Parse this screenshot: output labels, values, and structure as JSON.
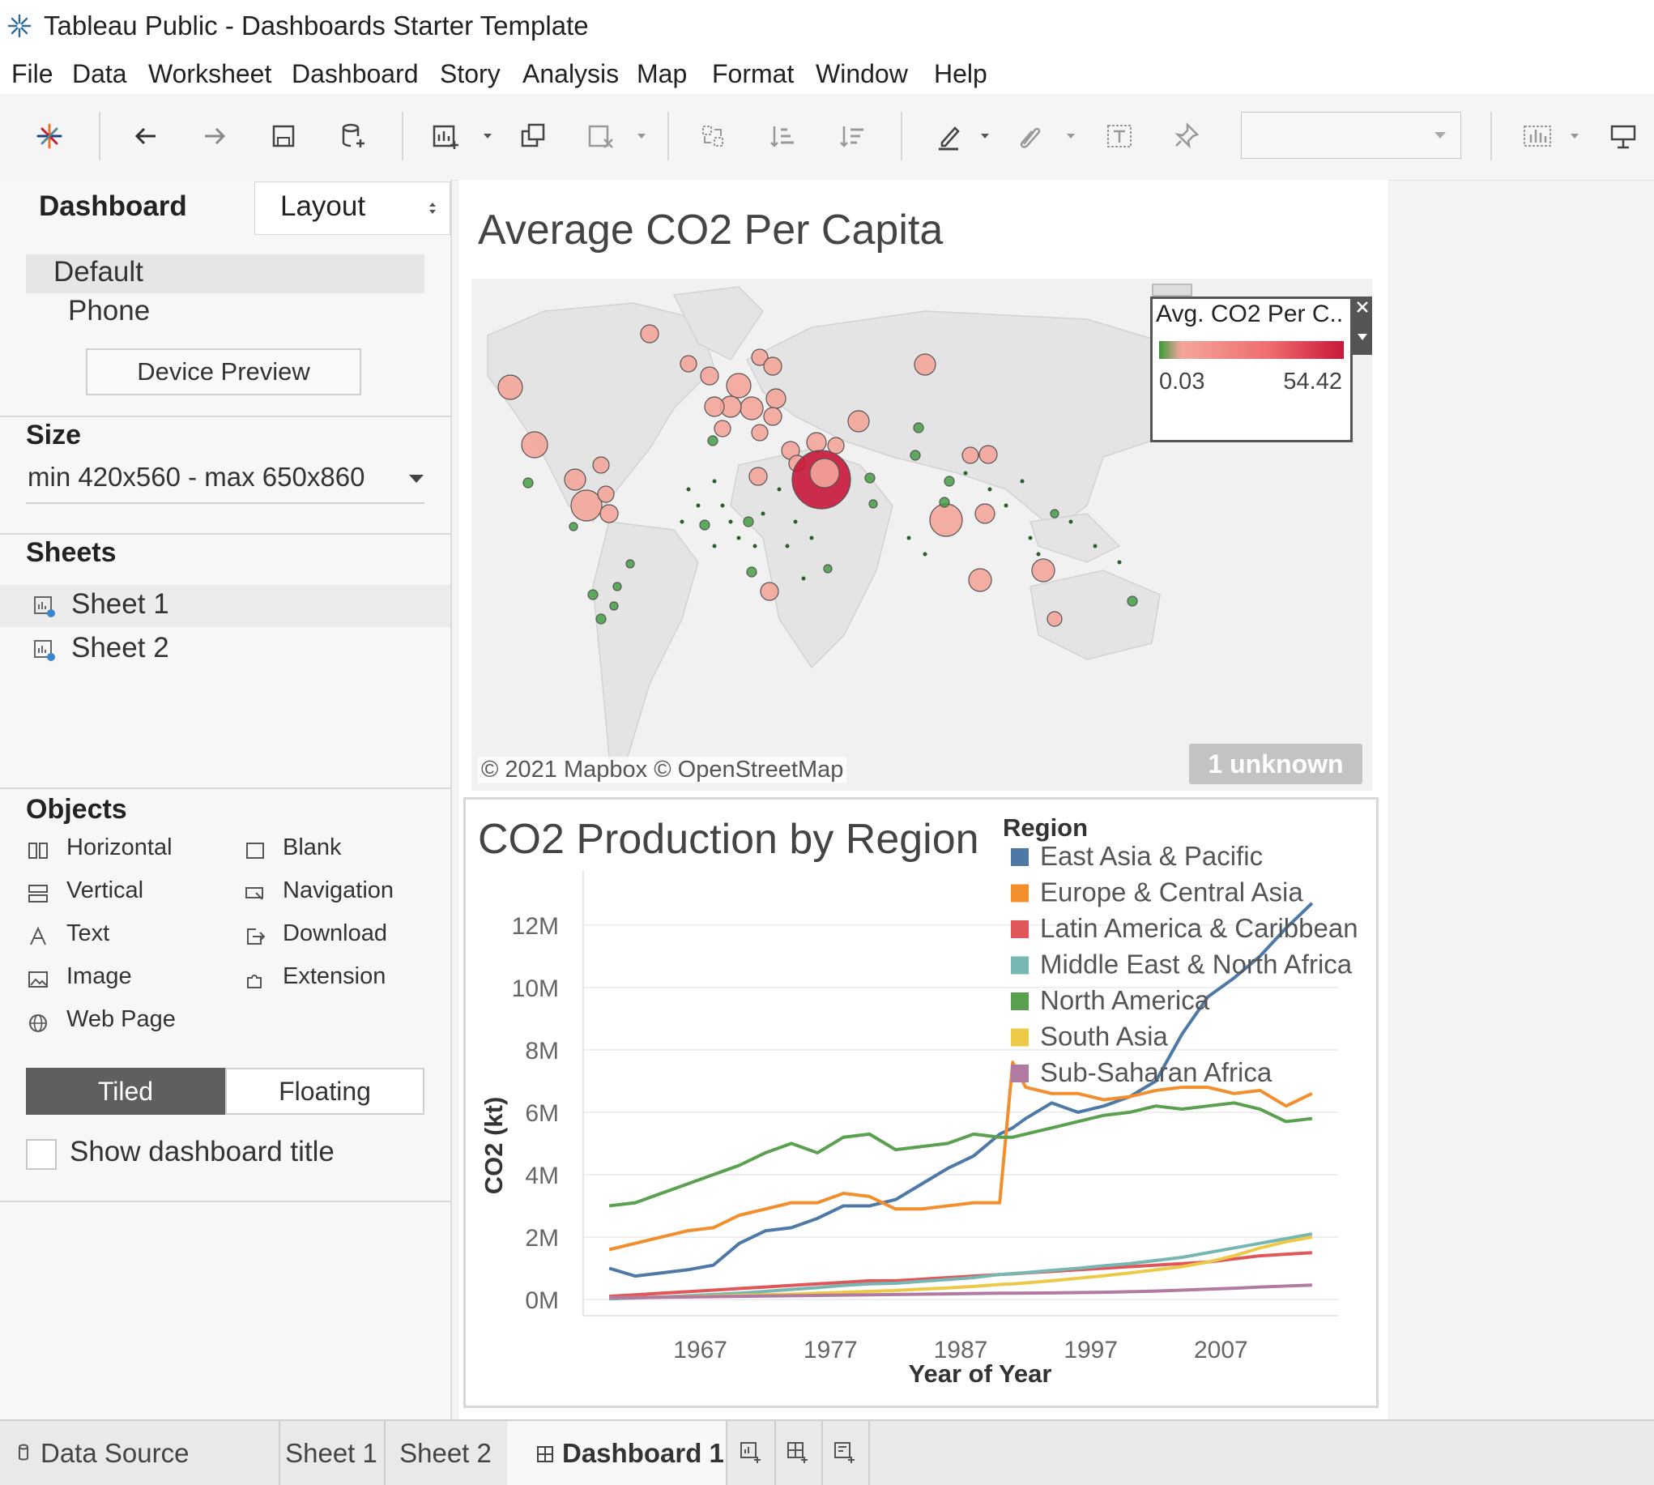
{
  "window": {
    "title": "Tableau Public - Dashboards Starter Template"
  },
  "menu": [
    "File",
    "Data",
    "Worksheet",
    "Dashboard",
    "Story",
    "Analysis",
    "Map",
    "Format",
    "Window",
    "Help"
  ],
  "toolbar": {
    "icons": [
      "tableau-logo-icon",
      "undo-icon",
      "redo-icon",
      "save-icon",
      "new-data-source-icon",
      "new-worksheet-icon",
      "duplicate-sheet-icon",
      "clear-sheet-icon",
      "swap-rows-columns-icon",
      "sort-ascending-icon",
      "sort-descending-icon",
      "highlight-icon",
      "annotate-icon",
      "show-labels-icon",
      "pin-icon",
      "show-me-icon",
      "presentation-mode-icon"
    ],
    "combo_value": ""
  },
  "left_panel": {
    "tab_dashboard": "Dashboard",
    "tab_layout": "Layout",
    "devices": [
      "Default",
      "Phone"
    ],
    "device_preview": "Device Preview",
    "size_heading": "Size",
    "size_value": "min 420x560 - max 650x860",
    "sheets_heading": "Sheets",
    "sheets": [
      "Sheet 1",
      "Sheet 2"
    ],
    "objects_heading": "Objects",
    "objects": [
      "Horizontal",
      "Blank",
      "Vertical",
      "Navigation",
      "Text",
      "Download",
      "Image",
      "Extension",
      "Web Page"
    ],
    "tiled": "Tiled",
    "floating": "Floating",
    "show_title": "Show dashboard title",
    "show_title_checked": false
  },
  "map": {
    "title": "Average CO2 Per Capita",
    "legend_title": "Avg. CO2 Per C..",
    "legend_min": "0.03",
    "legend_max": "54.42",
    "attribution": "© 2021 Mapbox © OpenStreetMap",
    "unknown_badge": "1 unknown",
    "colors": {
      "low": "#3a9a3a",
      "mid": "#f4a59a",
      "high": "#c8173a"
    }
  },
  "chart_data": {
    "type": "line",
    "title": "CO2 Production by Region",
    "xlabel": "Year of Year",
    "ylabel": "CO2 (kt)",
    "legend_title": "Region",
    "legend_position": "top-right",
    "x_ticks": [
      "1967",
      "1977",
      "1987",
      "1997",
      "2007"
    ],
    "y_ticks": [
      "0M",
      "2M",
      "4M",
      "6M",
      "8M",
      "10M",
      "12M"
    ],
    "ylim": [
      0,
      13500000
    ],
    "x": [
      1960,
      1962,
      1964,
      1966,
      1968,
      1970,
      1972,
      1974,
      1976,
      1978,
      1980,
      1982,
      1984,
      1986,
      1988,
      1990,
      1991,
      1992,
      1994,
      1996,
      1998,
      2000,
      2002,
      2004,
      2006,
      2008,
      2010,
      2012,
      2014
    ],
    "series": [
      {
        "name": "East Asia & Pacific",
        "color": "#4e79a7",
        "values": [
          1000000,
          750000,
          850000,
          950000,
          1100000,
          1800000,
          2200000,
          2300000,
          2600000,
          3000000,
          3000000,
          3200000,
          3700000,
          4200000,
          4600000,
          5300000,
          5500000,
          5800000,
          6300000,
          6000000,
          6200000,
          6500000,
          7000000,
          8500000,
          9700000,
          10300000,
          11000000,
          11900000,
          12700000
        ]
      },
      {
        "name": "Europe & Central Asia",
        "color": "#f28e2b",
        "values": [
          1600000,
          1800000,
          2000000,
          2200000,
          2300000,
          2700000,
          2900000,
          3100000,
          3100000,
          3400000,
          3300000,
          2900000,
          2900000,
          3000000,
          3100000,
          3100000,
          7600000,
          6800000,
          6600000,
          6600000,
          6400000,
          6500000,
          6700000,
          6800000,
          6800000,
          6600000,
          6700000,
          6200000,
          6600000
        ]
      },
      {
        "name": "Latin America & Caribbean",
        "color": "#e15759",
        "values": [
          100000,
          150000,
          200000,
          250000,
          300000,
          350000,
          400000,
          450000,
          500000,
          550000,
          600000,
          600000,
          650000,
          700000,
          750000,
          800000,
          820000,
          850000,
          900000,
          950000,
          1000000,
          1050000,
          1100000,
          1150000,
          1200000,
          1300000,
          1400000,
          1450000,
          1500000
        ]
      },
      {
        "name": "Middle East & North Africa",
        "color": "#76b7b2",
        "values": [
          20000,
          50000,
          80000,
          120000,
          160000,
          200000,
          260000,
          320000,
          380000,
          450000,
          500000,
          520000,
          580000,
          640000,
          700000,
          800000,
          830000,
          860000,
          930000,
          1000000,
          1080000,
          1150000,
          1250000,
          1350000,
          1500000,
          1650000,
          1800000,
          1950000,
          2100000
        ]
      },
      {
        "name": "North America",
        "color": "#59a14f",
        "values": [
          3000000,
          3100000,
          3400000,
          3700000,
          4000000,
          4300000,
          4700000,
          5000000,
          4700000,
          5200000,
          5300000,
          4800000,
          4900000,
          5000000,
          5300000,
          5200000,
          5200000,
          5300000,
          5500000,
          5700000,
          5900000,
          6000000,
          6200000,
          6100000,
          6200000,
          6300000,
          6100000,
          5700000,
          5800000
        ]
      },
      {
        "name": "South Asia",
        "color": "#edc948",
        "values": [
          50000,
          60000,
          70000,
          90000,
          110000,
          130000,
          150000,
          170000,
          200000,
          230000,
          260000,
          290000,
          330000,
          370000,
          420000,
          480000,
          500000,
          530000,
          600000,
          680000,
          760000,
          850000,
          950000,
          1050000,
          1200000,
          1400000,
          1650000,
          1850000,
          2000000
        ]
      },
      {
        "name": "Sub-Saharan Africa",
        "color": "#b07aa1",
        "values": [
          50000,
          60000,
          70000,
          80000,
          90000,
          100000,
          110000,
          120000,
          130000,
          140000,
          150000,
          160000,
          170000,
          180000,
          190000,
          200000,
          200000,
          205000,
          210000,
          220000,
          230000,
          250000,
          270000,
          300000,
          330000,
          360000,
          400000,
          430000,
          460000
        ]
      }
    ]
  },
  "status_bar": {
    "data_source": "Data Source",
    "tabs": [
      "Sheet 1",
      "Sheet 2"
    ],
    "active_tab": "Dashboard 1"
  }
}
